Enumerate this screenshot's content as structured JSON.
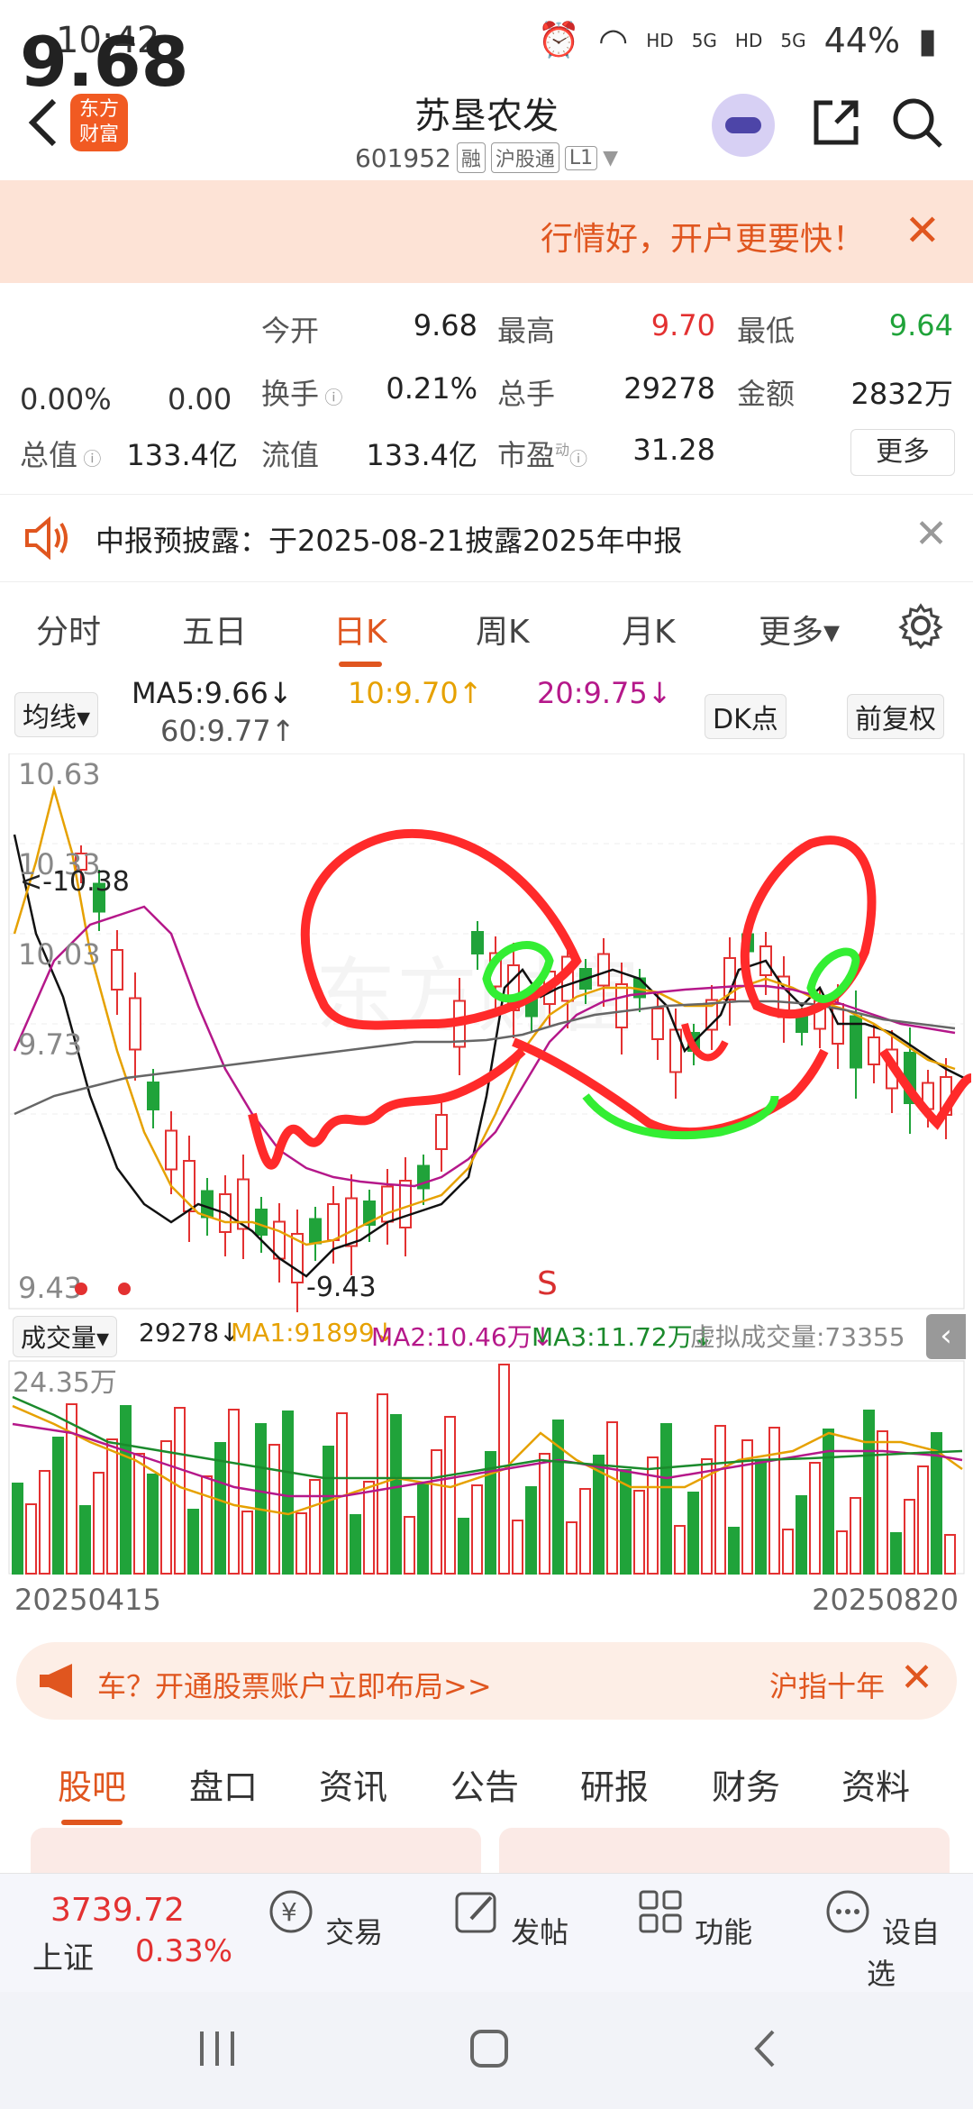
{
  "status": {
    "time": "10:42",
    "net1": "HD",
    "net2": "5G",
    "net3": "HD",
    "net4": "5G",
    "battery": "44%"
  },
  "header": {
    "logo_line1": "东方",
    "logo_line2": "财富",
    "title": "苏垦农发",
    "code": "601952",
    "tags": [
      "融",
      "沪股通",
      "L1"
    ]
  },
  "promo": {
    "text": "行情好，开户更要快！"
  },
  "quote": {
    "price": "9.68",
    "change_pct": "0.00%",
    "change_amt": "0.00",
    "items": [
      {
        "label": "今开",
        "value": "9.68",
        "color": "normal"
      },
      {
        "label": "最高",
        "value": "9.70",
        "color": "red"
      },
      {
        "label": "最低",
        "value": "9.64",
        "color": "green"
      },
      {
        "label": "换手",
        "value": "0.21%",
        "color": "normal"
      },
      {
        "label": "总手",
        "value": "29278",
        "color": "normal"
      },
      {
        "label": "金额",
        "value": "2832万",
        "color": "normal"
      },
      {
        "label": "总值",
        "value": "133.4亿",
        "color": "normal"
      },
      {
        "label": "流值",
        "value": "133.4亿",
        "color": "normal"
      },
      {
        "label": "市盈",
        "value": "31.28",
        "color": "normal"
      }
    ],
    "pe_superscript": "动",
    "more": "更多"
  },
  "notice": {
    "text": "中报预披露：于2025-08-21披露2025年中报"
  },
  "tabs": [
    "分时",
    "五日",
    "日K",
    "周K",
    "月K",
    "更多▾"
  ],
  "ma": {
    "selector": "均线▾",
    "ma5": "MA5:9.66↓",
    "ma10": "10:9.70↑",
    "ma20": "20:9.75↓",
    "ma60": "60:9.77↑",
    "dk": "DK点",
    "adj": "前复权"
  },
  "kchart": {
    "price_labels": [
      "10.63",
      "10.33",
      "10.03",
      "9.73",
      "9.43"
    ],
    "high_marker": "10.38",
    "low_marker": "9.43",
    "signal": "S",
    "watermark": "东方财富"
  },
  "vol": {
    "selector": "成交量▾",
    "value": "29278↓",
    "ma1": "MA1:91899↓",
    "ma2": "MA2:10.46万↓",
    "ma3": "MA3:11.72万↓",
    "virtual": "虚拟成交量:73355",
    "max_label": "24.35万",
    "date_start": "20250415",
    "date_end": "20250820"
  },
  "ad": {
    "text": "车？开通股票账户立即布局>>",
    "text2": "沪指十年"
  },
  "bottom_tabs": [
    "股吧",
    "盘口",
    "资讯",
    "公告",
    "研报",
    "财务",
    "资料"
  ],
  "bnav": {
    "index_value": "3739.72",
    "index_name": "上证",
    "index_pct": "0.33%",
    "items": [
      "交易",
      "发帖",
      "功能",
      "设自选"
    ]
  },
  "colors": {
    "accent": "#e0561f",
    "up": "#e33131",
    "down": "#20a33a"
  }
}
